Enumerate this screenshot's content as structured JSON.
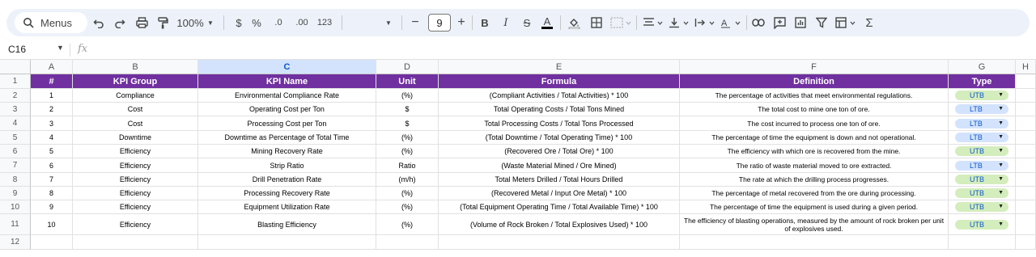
{
  "toolbar": {
    "search_label": "Menus",
    "zoom": "100%",
    "currency": "$",
    "percent": "%",
    "dec_decrease": ".0",
    "dec_increase": ".00",
    "number_format": "123",
    "font_size": "9",
    "minus": "−",
    "plus": "+",
    "bold": "B",
    "italic": "I",
    "strike": "S",
    "text_color": "A",
    "sum": "Σ"
  },
  "formula_bar": {
    "cell_ref": "C16",
    "fx": "fx"
  },
  "columns": [
    "A",
    "B",
    "C",
    "D",
    "E",
    "F",
    "G",
    "H"
  ],
  "rows": [
    "1",
    "2",
    "3",
    "4",
    "5",
    "6",
    "7",
    "8",
    "9",
    "10",
    "11",
    "12"
  ],
  "header": {
    "num": "#",
    "group": "KPI Group",
    "name": "KPI Name",
    "unit": "Unit",
    "formula": "Formula",
    "definition": "Definition",
    "type": "Type"
  },
  "kpis": [
    {
      "num": "1",
      "group": "Compliance",
      "name": "Environmental Compliance Rate",
      "unit": "(%)",
      "formula": "(Compliant Activities / Total Activities) * 100",
      "definition": "The percentage of activities that meet environmental regulations.",
      "type": "UTB"
    },
    {
      "num": "2",
      "group": "Cost",
      "name": "Operating Cost per Ton",
      "unit": "$",
      "formula": "Total Operating Costs / Total Tons Mined",
      "definition": "The total cost to mine one ton of ore.",
      "type": "LTB"
    },
    {
      "num": "3",
      "group": "Cost",
      "name": "Processing Cost per Ton",
      "unit": "$",
      "formula": "Total Processing Costs / Total Tons Processed",
      "definition": "The cost incurred to process one ton of ore.",
      "type": "LTB"
    },
    {
      "num": "4",
      "group": "Downtime",
      "name": "Downtime as Percentage of Total Time",
      "unit": "(%)",
      "formula": "(Total Downtime / Total Operating Time) * 100",
      "definition": "The percentage of time the equipment is down and not operational.",
      "type": "LTB"
    },
    {
      "num": "5",
      "group": "Efficiency",
      "name": "Mining Recovery Rate",
      "unit": "(%)",
      "formula": "(Recovered Ore / Total Ore) * 100",
      "definition": "The efficiency with which ore is recovered from the mine.",
      "type": "UTB"
    },
    {
      "num": "6",
      "group": "Efficiency",
      "name": "Strip Ratio",
      "unit": "Ratio",
      "formula": "(Waste Material Mined / Ore Mined)",
      "definition": "The ratio of waste material moved to ore extracted.",
      "type": "LTB"
    },
    {
      "num": "7",
      "group": "Efficiency",
      "name": "Drill Penetration Rate",
      "unit": "(m/h)",
      "formula": "Total Meters Drilled / Total Hours Drilled",
      "definition": "The rate at which the drilling process progresses.",
      "type": "UTB"
    },
    {
      "num": "8",
      "group": "Efficiency",
      "name": "Processing Recovery Rate",
      "unit": "(%)",
      "formula": "(Recovered Metal / Input Ore Metal) * 100",
      "definition": "The percentage of metal recovered from the ore during processing.",
      "type": "UTB"
    },
    {
      "num": "9",
      "group": "Efficiency",
      "name": "Equipment Utilization Rate",
      "unit": "(%)",
      "formula": "(Total Equipment Operating Time / Total Available Time) * 100",
      "definition": "The percentage of time the equipment is used during a given period.",
      "type": "UTB"
    },
    {
      "num": "10",
      "group": "Efficiency",
      "name": "Blasting Efficiency",
      "unit": "(%)",
      "formula": "(Volume of Rock Broken / Total Explosives Used) * 100",
      "definition": "The efficiency of blasting operations, measured by the amount of rock broken per unit of explosives used.",
      "type": "UTB"
    }
  ],
  "colors": {
    "header_bg": "#7030a0",
    "utb_chip": "#d4edbc",
    "ltb_chip": "#d3e3fd",
    "chip_text": "#0b57d0"
  }
}
